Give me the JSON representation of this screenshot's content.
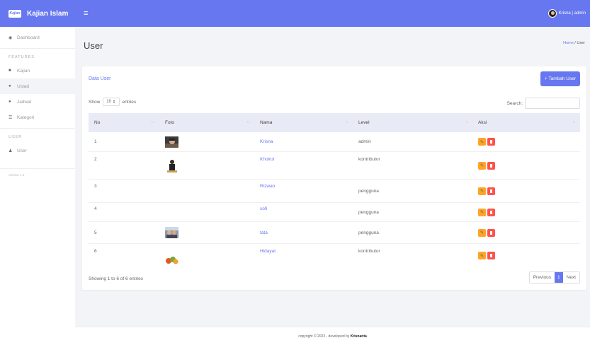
{
  "brand": {
    "logo_text": "Kajian",
    "title": "Kajian Islam"
  },
  "topbar": {
    "menu_icon": "hamburger-icon",
    "user_label": "Krisna | admin"
  },
  "sidebar": {
    "items": [
      {
        "icon": "dashboard-icon",
        "label": "Dashboard"
      },
      {
        "icon": "video-icon",
        "label": "Kajian"
      },
      {
        "icon": "users-icon",
        "label": "Ustad"
      },
      {
        "icon": "users-icon",
        "label": "Jadwal"
      },
      {
        "icon": "list-icon",
        "label": "Kategori"
      },
      {
        "icon": "user-icon",
        "label": "User"
      }
    ],
    "features_header": "FEATURES",
    "user_header": "USER",
    "version": "Version 1.1"
  },
  "page": {
    "title": "User",
    "breadcrumb_home": "Home",
    "breadcrumb_sep": " / ",
    "breadcrumb_current": "User"
  },
  "card": {
    "title": "Data User",
    "add_button": "+ Tambah User"
  },
  "table": {
    "show_prefix": "Show",
    "page_size": "10",
    "show_suffix": "entries",
    "search_label": "Search:",
    "columns": [
      "No",
      "Foto",
      "Nama",
      "Level",
      "Aksi"
    ],
    "rows": [
      {
        "no": "1",
        "nama": "Krisna",
        "level": "admin",
        "has_photo": true
      },
      {
        "no": "2",
        "nama": "Khoirul",
        "level": "kontributor",
        "has_photo": true
      },
      {
        "no": "3",
        "nama": "Rizwan",
        "level": "pengguna",
        "has_photo": false
      },
      {
        "no": "4",
        "nama": "sofi",
        "level": "pengguna",
        "has_photo": false
      },
      {
        "no": "5",
        "nama": "tata",
        "level": "pengguna",
        "has_photo": true
      },
      {
        "no": "6",
        "nama": "Hidayat",
        "level": "kontributor",
        "has_photo": true
      }
    ],
    "info": "Showing 1 to 6 of 6 entries",
    "pagination": {
      "previous": "Previous",
      "current": "1",
      "next": "Next"
    }
  },
  "footer": {
    "text": "copyright © 2023 - developed by",
    "author": "Krisnanta"
  },
  "colors": {
    "primary": "#6777ef",
    "warning": "#ffa426",
    "danger": "#fc544b"
  }
}
